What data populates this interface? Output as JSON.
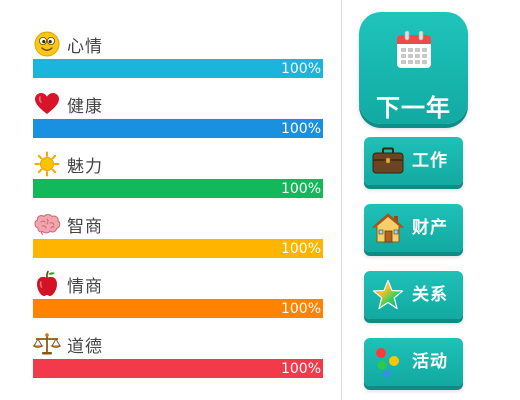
{
  "stats": [
    {
      "label": "心情",
      "icon": "smiley-face-icon",
      "percent_text": "100%",
      "level": 1.0,
      "color": "#1ab4dc"
    },
    {
      "label": "健康",
      "icon": "heart-icon",
      "percent_text": "100%",
      "level": 1.0,
      "color": "#1a90e0"
    },
    {
      "label": "魅力",
      "icon": "sun-icon",
      "percent_text": "100%",
      "level": 1.0,
      "color": "#12b85a"
    },
    {
      "label": "智商",
      "icon": "brain-icon",
      "percent_text": "100%",
      "level": 1.0,
      "color": "#ffb400"
    },
    {
      "label": "情商",
      "icon": "apple-icon",
      "percent_text": "100%",
      "level": 1.0,
      "color": "#ff8200"
    },
    {
      "label": "道德",
      "icon": "scales-icon",
      "percent_text": "100%",
      "level": 1.0,
      "color": "#f23a4a"
    }
  ],
  "next_year": {
    "label": "下一年",
    "icon": "calendar-icon"
  },
  "actions": [
    {
      "label": "工作",
      "icon": "briefcase-icon"
    },
    {
      "label": "财产",
      "icon": "house-icon"
    },
    {
      "label": "关系",
      "icon": "star-icon"
    },
    {
      "label": "活动",
      "icon": "dots-icon"
    }
  ],
  "colors": {
    "button_teal": "#18b6ad"
  }
}
